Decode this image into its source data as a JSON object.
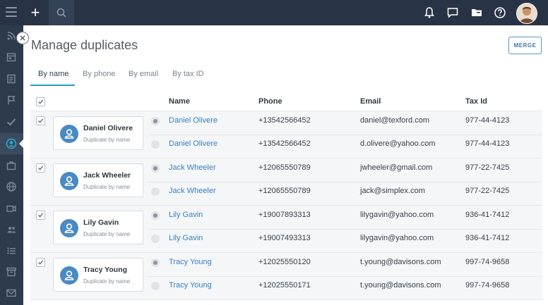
{
  "page": {
    "title": "Manage duplicates",
    "merge_label": "MERGE"
  },
  "topbar": {
    "plus": "+"
  },
  "tabs": [
    {
      "label": "By name",
      "active": true
    },
    {
      "label": "By phone",
      "active": false
    },
    {
      "label": "By email",
      "active": false
    },
    {
      "label": "By tax ID",
      "active": false
    }
  ],
  "table": {
    "headers": {
      "name": "Name",
      "phone": "Phone",
      "email": "Email",
      "tax": "Tax Id"
    },
    "groups": [
      {
        "card_name": "Daniel Olivere",
        "card_sub": "Duplicate by name",
        "rows": [
          {
            "name": "Daniel Olivere",
            "phone": "+13542566452",
            "email": "daniel@texford.com",
            "tax": "977-44-4123"
          },
          {
            "name": "Daniel Olivere",
            "phone": "+13542566452",
            "email": "d.olivere@yahoo.com",
            "tax": "977-44-4123"
          }
        ]
      },
      {
        "card_name": "Jack Wheeler",
        "card_sub": "Duplicate by name",
        "rows": [
          {
            "name": "Jack Wheeler",
            "phone": "+12065550789",
            "email": "jwheeler@gmail.com",
            "tax": "977-22-7425"
          },
          {
            "name": "Jack Wheeler",
            "phone": "+12065550789",
            "email": "jack@simplex.com",
            "tax": "977-22-7425"
          }
        ]
      },
      {
        "card_name": "Lily Gavin",
        "card_sub": "Duplicate by name",
        "rows": [
          {
            "name": "Lily Gavin",
            "phone": "+19007893313",
            "email": "lilygavin@yahoo.com",
            "tax": "936-41-7412"
          },
          {
            "name": "Lily Gavin",
            "phone": "+19007493313",
            "email": "lilygavin@yahoo.com",
            "tax": "936-41-7412"
          }
        ]
      },
      {
        "card_name": "Tracy Young",
        "card_sub": "Duplicate by name",
        "rows": [
          {
            "name": "Tracy Young",
            "phone": "+12025550120",
            "email": "t.young@davisons.com",
            "tax": "997-74-9658"
          },
          {
            "name": "Tracy Young",
            "phone": "+12025550171",
            "email": "t.young@davisons.com",
            "tax": "997-74-9658"
          }
        ]
      }
    ]
  },
  "colors": {
    "topbar": "#283445",
    "sidebar": "#2e3b4d",
    "accent": "#1ea0c3",
    "link": "#3b7fc0",
    "avatar": "#4a8ac4"
  },
  "icons": {
    "topbar": [
      "menu-icon",
      "plus-icon",
      "search-icon",
      "bell-icon",
      "chat-icon",
      "folder-icon",
      "help-icon"
    ],
    "sidebar": [
      "rss-icon",
      "calendar-icon",
      "document-icon",
      "flag-icon",
      "check-icon",
      "contact-icon",
      "briefcase-icon",
      "globe-icon",
      "video-icon",
      "users-icon",
      "list-icon",
      "archive-icon",
      "mail-icon"
    ]
  }
}
